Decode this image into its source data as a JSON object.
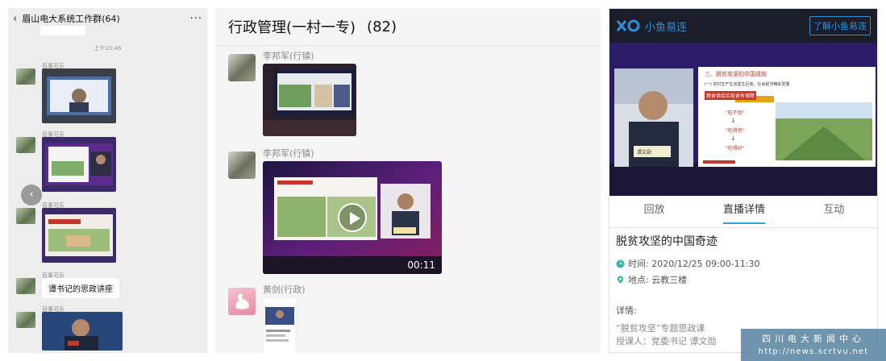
{
  "panel1": {
    "title": "眉山电大系统工作群(64)",
    "timestamp": "上午10:46",
    "sender": "百事可乐",
    "text_message": "谭书记的思政讲座",
    "back_icon": "chevron-left-icon",
    "more_icon": "more-icon"
  },
  "panel2": {
    "group_name": "行政管理(一村一专)",
    "member_count": "(82)",
    "messages": [
      {
        "sender": "李邦军(行镇)"
      },
      {
        "sender": "李邦军(行镇)",
        "duration": "00:11"
      },
      {
        "sender": "黄剑(行政)"
      }
    ]
  },
  "panel3": {
    "brand": "小鱼易连",
    "about_button": "了解小鱼易连",
    "tabs": [
      "回放",
      "直播详情",
      "互动"
    ],
    "active_tab": 1,
    "event_title": "脱贫攻坚的中国奇迹",
    "time": "时间: 2020/12/25 09:00-11:30",
    "location": "地点: 云教三楼",
    "details_label": "详情:",
    "detail_line1": "“脱贫攻坚”专题思政课",
    "detail_line2": "授课人：党委书记  谭文勋",
    "slide": {
      "heading": "三、脱贫攻坚的中国成就",
      "subheading": "(一) 农村生产生活发生巨变，社会经济精彩发展",
      "highlight": "粮食供给实现食有保障",
      "steps": [
        "\"吃不饱\"",
        "\"吃得饱\"",
        "\"吃得好\""
      ],
      "nameplate": "谭文勋"
    },
    "accent_color": "#29a8d6"
  },
  "watermark": {
    "line1": "四川电大新闻中心",
    "line2": "http://news.scrtvu.net"
  }
}
